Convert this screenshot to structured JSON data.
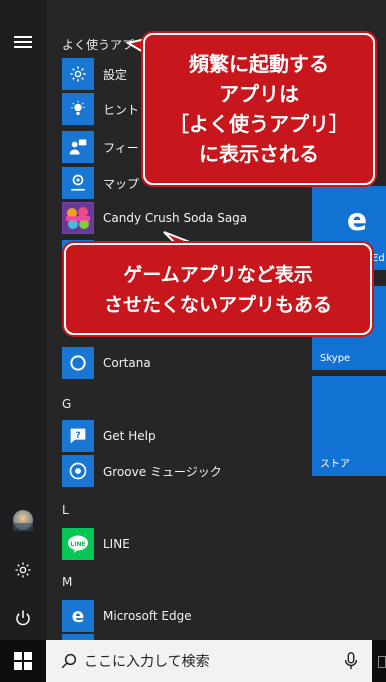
{
  "rail": {
    "menu_icon": "hamburger-icon",
    "avatar_icon": "user-avatar",
    "settings_icon": "gear-icon",
    "power_icon": "power-icon"
  },
  "list": {
    "section_frequent": "よく使うアプリ",
    "frequent": [
      {
        "label": "設定",
        "icon": "gear-icon"
      },
      {
        "label": "ヒント",
        "icon": "lightbulb-icon"
      },
      {
        "label": "フィードバ",
        "icon": "feedback-icon"
      },
      {
        "label": "マップ",
        "icon": "map-icon"
      },
      {
        "label": "Candy Crush Soda Saga",
        "icon": "candy-crush-icon"
      }
    ],
    "c_apps": [
      {
        "label": "Cortana",
        "icon": "cortana-icon"
      }
    ],
    "section_g": "G",
    "g_apps": [
      {
        "label": "Get Help",
        "icon": "help-icon"
      },
      {
        "label": "Groove ミュージック",
        "icon": "groove-icon"
      }
    ],
    "section_l": "L",
    "l_apps": [
      {
        "label": "LINE",
        "icon": "line-icon"
      }
    ],
    "section_m": "M",
    "m_apps": [
      {
        "label": "Microsoft Edge",
        "icon": "edge-icon"
      }
    ]
  },
  "tiles": {
    "edge_label": "Ed",
    "skype_label": "Skype",
    "store_label": "ストア"
  },
  "callouts": {
    "frequent": [
      "頻繁に起動する",
      "アプリは",
      "［よく使うアプリ］",
      "に表示される"
    ],
    "games": [
      "ゲームアプリなど表示",
      "させたくないアプリもある"
    ]
  },
  "taskbar": {
    "search_placeholder": "ここに入力して検索"
  },
  "colors": {
    "accent": "#1976d2",
    "callout_red": "#c8161d",
    "line_green": "#06c755"
  }
}
